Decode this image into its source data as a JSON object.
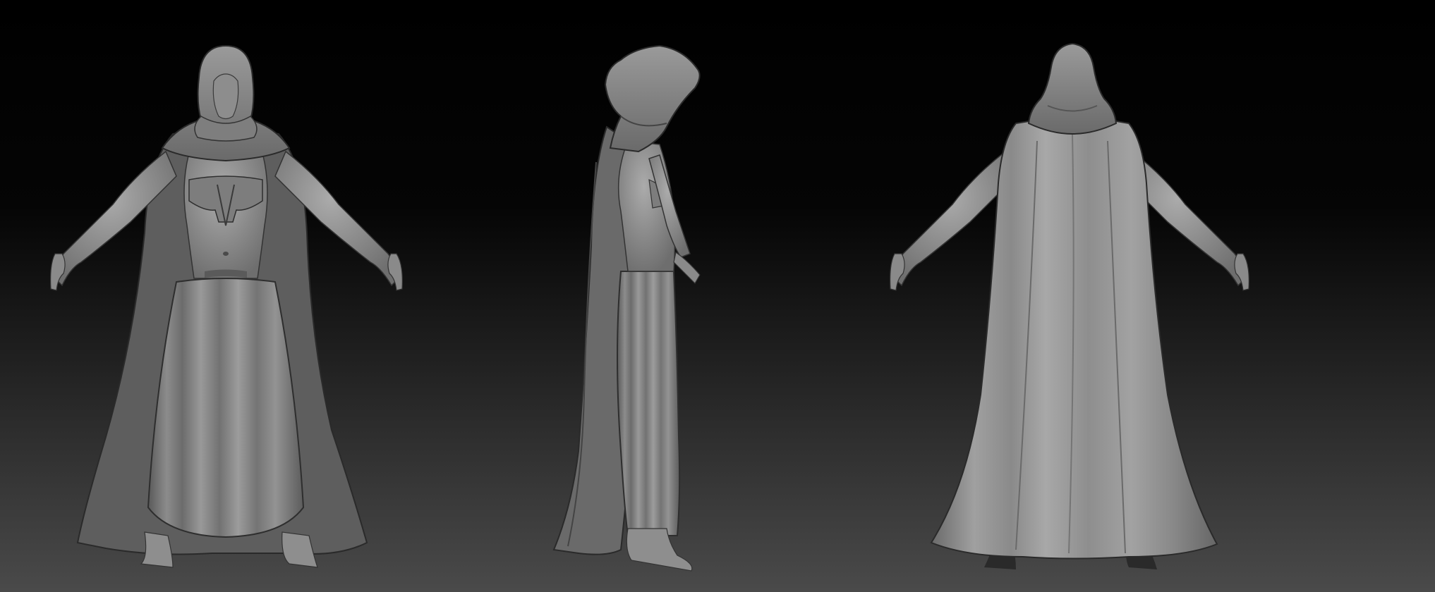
{
  "scene": {
    "background_top": "#000000",
    "background_bottom": "#4a4a4a",
    "model_base_color": "#8a8a8a",
    "model_highlight_color": "#b5b5b5",
    "model_shadow_color": "#3a3a3a",
    "views": [
      {
        "name": "front"
      },
      {
        "name": "side"
      },
      {
        "name": "back"
      }
    ]
  }
}
